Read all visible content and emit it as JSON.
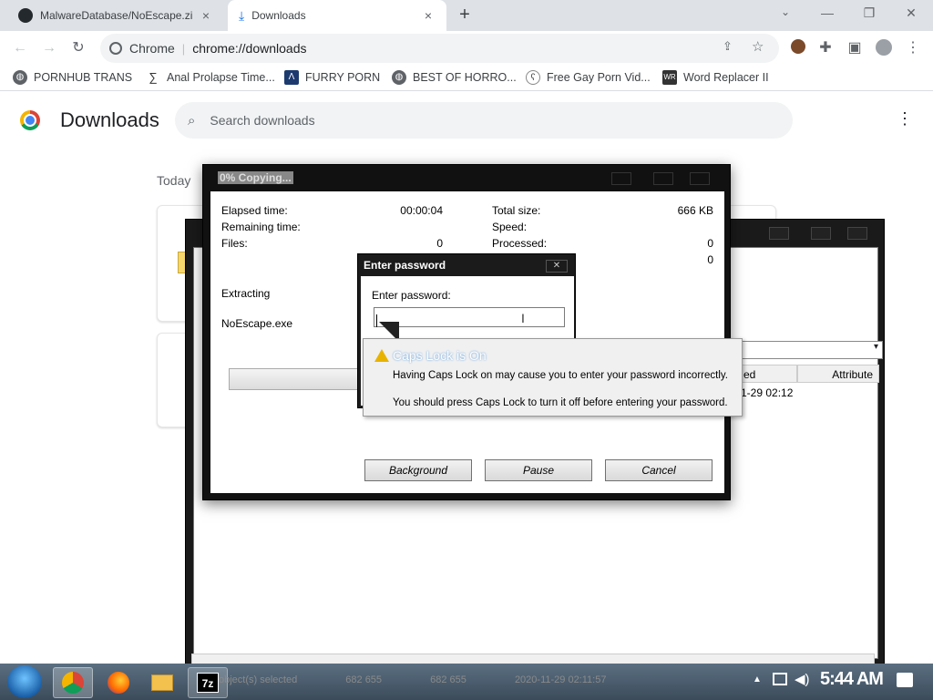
{
  "tabs": [
    {
      "title": "MalwareDatabase/NoEscape.zi",
      "close": "×"
    },
    {
      "title": "Downloads",
      "close": "×"
    }
  ],
  "new_tab": "+",
  "window_controls": {
    "minimize": "—",
    "restore": "❐",
    "close": "✕"
  },
  "omnibox": {
    "site": "Chrome",
    "separator": "|",
    "url": "chrome://downloads"
  },
  "bookmarks": [
    {
      "label": "PORNHUB TRANS"
    },
    {
      "label": "Anal Prolapse Time..."
    },
    {
      "label": "FURRY PORN"
    },
    {
      "label": "BEST OF HORRO..."
    },
    {
      "label": "Free Gay Porn Vid..."
    },
    {
      "label": "Word Replacer II"
    }
  ],
  "downloads": {
    "title": "Downloads",
    "search_placeholder": "Search downloads",
    "section": "Today"
  },
  "copy_dialog": {
    "title": "0% Copying...",
    "elapsed_label": "Elapsed time:",
    "elapsed_value": "00:00:04",
    "remaining_label": "Remaining time:",
    "files_label": "Files:",
    "files_value": "0",
    "total_label": "Total size:",
    "total_value": "666 KB",
    "speed_label": "Speed:",
    "processed_label": "Processed:",
    "processed_value": "0",
    "extra_value": "0",
    "extracting": "Extracting",
    "filename": "NoEscape.exe",
    "progress": 0,
    "buttons": {
      "background": "Background",
      "pause": "Pause",
      "cancel": "Cancel"
    }
  },
  "password_dialog": {
    "title": "Enter password",
    "label": "Enter password:",
    "value": "",
    "close": "✕"
  },
  "caps_tip": {
    "heading": "Caps Lock is On",
    "line1": "Having Caps Lock on may cause you to enter your password incorrectly.",
    "line2": "You should press Caps Lock to turn it off before entering your password."
  },
  "sevenzip": {
    "col_modified": "ed",
    "col_attributes": "Attribute",
    "row_modified": "1-29 02:12",
    "dropdown_arrow": "▾"
  },
  "statusbar": {
    "selected": "object(s) selected",
    "size1": "682 655",
    "size2": "682 655",
    "date": "2020-11-29 02:11:57"
  },
  "taskbar": {
    "clock": "5:44 AM"
  },
  "colors": {
    "chrome_bg": "#dee1e6",
    "taskbar": "#4a5c6e"
  }
}
